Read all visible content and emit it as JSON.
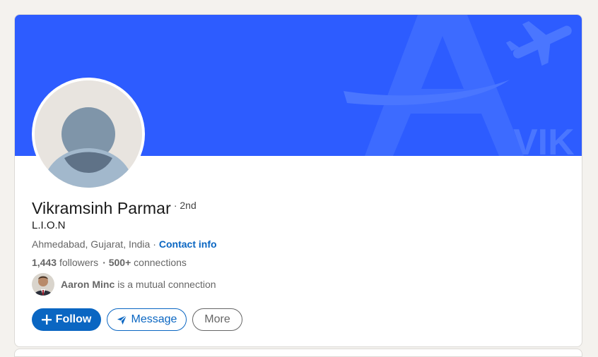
{
  "profile": {
    "name": "Vikramsinh Parmar",
    "degree": "· 2nd",
    "headline": "L.I.O.N",
    "location": "Ahmedabad, Gujarat, India ·",
    "contact_info": "Contact info",
    "followers_count": "1,443",
    "followers_label": "followers",
    "connections_count": "· 500+",
    "connections_label": "connections"
  },
  "mutual": {
    "name": "Aaron Minc",
    "text": "is a mutual connection"
  },
  "banner": {
    "color": "#2d5cff",
    "watermark_text": "VIK"
  },
  "actions": {
    "follow_label": "Follow",
    "message_label": "Message",
    "more_label": "More"
  },
  "icons": {
    "follow": "plus-icon",
    "message": "send-icon"
  },
  "colors": {
    "accent": "#0a66c2",
    "banner": "#2d5cff"
  }
}
